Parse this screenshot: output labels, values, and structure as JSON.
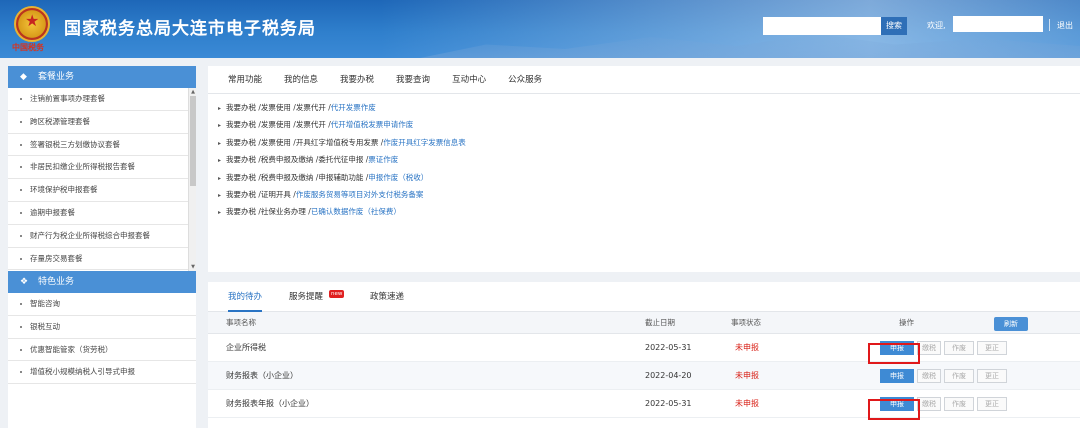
{
  "header": {
    "title": "国家税务总局大连市电子税务局",
    "emblem_text": "中国税务",
    "search_button": "搜索",
    "welcome": "欢迎,",
    "logout": "退出"
  },
  "sidebar": {
    "section1": "套餐业务",
    "items1": [
      "注销前置事项办理套餐",
      "跨区税源管理套餐",
      "签署银税三方划缴协议套餐",
      "非居民扣缴企业所得税报告套餐",
      "环境保护税申报套餐",
      "逾期申报套餐",
      "财产行为税企业所得税综合申报套餐",
      "存量房交易套餐"
    ],
    "section2": "特色业务",
    "items2": [
      "智能咨询",
      "银税互动",
      "优惠智能管家（货劳税）",
      "增值税小规模纳税人引导式申报"
    ]
  },
  "top_tabs": [
    "常用功能",
    "我的信息",
    "我要办税",
    "我要查询",
    "互动中心",
    "公众服务"
  ],
  "quick_links": [
    {
      "path": "我要办税 /发票使用 /发票代开 /",
      "target": "代开发票作废"
    },
    {
      "path": "我要办税 /发票使用 /发票代开 /",
      "target": "代开增值税发票申请作废"
    },
    {
      "path": "我要办税 /发票使用 /开具红字增值税专用发票 /",
      "target": "作废开具红字发票信息表"
    },
    {
      "path": "我要办税 /税费申报及缴纳 /委托代征申报 /",
      "target": "票证作废"
    },
    {
      "path": "我要办税 /税费申报及缴纳 /申报辅助功能 /",
      "target": "申报作废（税收）"
    },
    {
      "path": "我要办税 /证明开具 /",
      "target": "作废服务贸易等项目对外支付税务备案"
    },
    {
      "path": "我要办税 /社保业务办理 /",
      "target": "已确认数据作废（社保费）"
    }
  ],
  "bottom_tabs": {
    "todo": "我的待办",
    "reminder": "服务提醒",
    "new_badge": "new",
    "policy": "政策速递"
  },
  "table": {
    "headers": {
      "name": "事项名称",
      "deadline": "截止日期",
      "status": "事项状态",
      "ops": "操作"
    },
    "refresh": "刷新",
    "op_labels": {
      "declare": "申报",
      "pay": "缴税",
      "void": "作废",
      "correct": "更正"
    },
    "rows": [
      {
        "name": "企业所得税",
        "deadline": "2022-05-31",
        "status": "未申报"
      },
      {
        "name": "财务报表（小企业）",
        "deadline": "2022-04-20",
        "status": "未申报"
      },
      {
        "name": "财务报表年报（小企业）",
        "deadline": "2022-05-31",
        "status": "未申报"
      }
    ]
  },
  "colors": {
    "brand": "#2f7fcc",
    "accent": "#4a90d6",
    "status_red": "#d9231a",
    "highlight": "#e0181a"
  }
}
